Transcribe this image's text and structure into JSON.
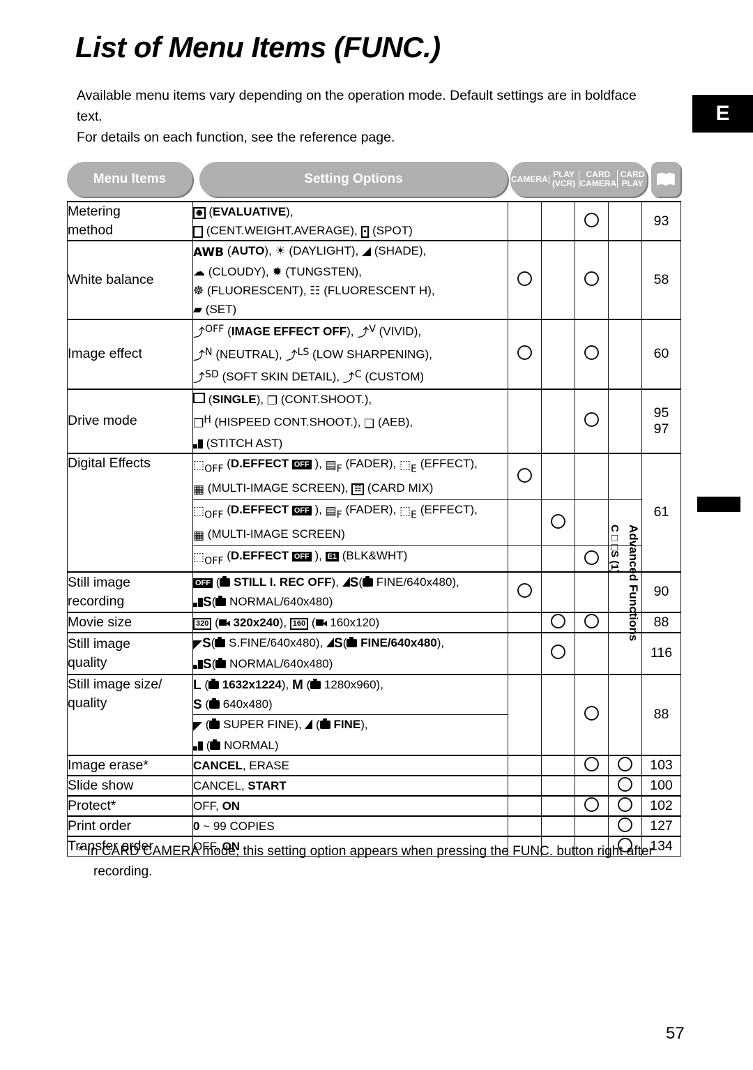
{
  "header": {
    "title": "List of Menu Items (FUNC.)",
    "intro_line1": "Available menu items vary depending on the operation mode. Default settings are in boldface text.",
    "intro_line2": "For details on each function, see the reference page.",
    "edition_badge": "E"
  },
  "table": {
    "col_menu_items": "Menu Items",
    "col_setting_options": "Setting Options",
    "mode_columns": [
      {
        "line1": "CAMERA",
        "line2": ""
      },
      {
        "line1": "PLAY",
        "line2": "(VCR)"
      },
      {
        "line1": "CARD",
        "line2": "CAMERA"
      },
      {
        "line1": "CARD",
        "line2": "PLAY"
      }
    ],
    "reference_icon": "open-book-icon",
    "rows": [
      {
        "name": "Metering\nmethod",
        "options_html": "<span class=\"gbox\">◉</span> (<b>EVALUATIVE</b>),<br><span class=\"gbox\">&nbsp;&nbsp;</span> (CENT.WEIGHT.AVERAGE), <span class=\"gbox\">▪</span> (SPOT)",
        "options_text": "(EVALUATIVE), (CENT.WEIGHT.AVERAGE), (SPOT)",
        "marks": [
          false,
          false,
          true,
          false
        ],
        "ref": "93"
      },
      {
        "name": "White balance",
        "options_html": "<b class=\"g\">AWB</b> (<b>AUTO</b>), ☀ (DAYLIGHT), ◢ (SHADE),<br>☁ (CLOUDY), ✹ (TUNGSTEN),<br>☸ (FLUORESCENT), ☷ (FLUORESCENT H),<br>▰ (SET)",
        "options_text": "AWB (AUTO), (DAYLIGHT), (SHADE), (CLOUDY), (TUNGSTEN), (FLUORESCENT), (FLUORESCENT H), (SET)",
        "marks": [
          true,
          false,
          true,
          false
        ],
        "ref": "58"
      },
      {
        "name": "Image effect",
        "options_html": "<span class=\"g\">⤴<sup>OFF</sup></span> (<b>IMAGE EFFECT OFF</b>), <span class=\"g\">⤴<sup>V</sup></span> (VIVID),<br><span class=\"g\">⤴<sup>N</sup></span> (NEUTRAL), <span class=\"g\">⤴<sup>LS</sup></span> (LOW SHARPENING),<br><span class=\"g\">⤴<sup>SD</sup></span> (SOFT SKIN DETAIL), <span class=\"g\">⤴<sup>C</sup></span> (CUSTOM)",
        "options_text": "(IMAGE EFFECT OFF), (VIVID), (NEUTRAL), (LOW SHARPENING), (SOFT SKIN DETAIL), (CUSTOM)",
        "marks": [
          true,
          false,
          true,
          false
        ],
        "ref": "60"
      },
      {
        "name": "Drive mode",
        "options_html": "<span class=\"gsq\"></span> (<b>SINGLE</b>), <span class=\"g\">❐</span> (CONT.SHOOT.),<br><span class=\"g\">❐<sup>H</sup></span> (HISPEED CONT.SHOOT.), <span class=\"g\">❑</span> (AEB),<br><span class=\"gstep\"></span> (STITCH AST)",
        "options_text": "(SINGLE), (CONT.SHOOT.), (HISPEED CONT.SHOOT.), (AEB), (STITCH AST)",
        "marks": [
          false,
          false,
          true,
          false
        ],
        "ref": "95\n97"
      },
      {
        "name": "Digital Effects",
        "sub_rows": [
          {
            "options_html": "<span class=\"g\">⬚<sub>OFF</sub></span> (<b>D.EFFECT <span class=\"ginv\">OFF</span></b> ), <span class=\"g\">▤<sub>F</sub></span> (FADER), <span class=\"g\">⬚<sub>E</sub></span> (EFFECT),<br><span class=\"g\">▦</span> (MULTI-IMAGE SCREEN), <span class=\"gbox\">☷</span> (CARD MIX)",
            "options_text": "(D.EFFECT OFF), (FADER), (EFFECT), (MULTI-IMAGE SCREEN), (CARD MIX)",
            "marks": [
              true,
              false,
              false,
              false
            ]
          },
          {
            "options_html": "<span class=\"g\">⬚<sub>OFF</sub></span> (<b>D.EFFECT <span class=\"ginv\">OFF</span></b> ), <span class=\"g\">▤<sub>F</sub></span> (FADER), <span class=\"g\">⬚<sub>E</sub></span> (EFFECT),<br><span class=\"g\">▦</span> (MULTI-IMAGE SCREEN)",
            "options_text": "(D.EFFECT OFF), (FADER), (EFFECT), (MULTI-IMAGE SCREEN)",
            "marks": [
              false,
              true,
              false,
              false
            ]
          },
          {
            "options_html": "<span class=\"g\">⬚<sub>OFF</sub></span> (<b>D.EFFECT <span class=\"ginv\">OFF</span></b> ), <span class=\"ginv\">E1</span> (BLK&amp;WHT)",
            "options_text": "(D.EFFECT OFF), (BLK&WHT)",
            "marks": [
              false,
              false,
              true,
              false
            ]
          }
        ],
        "ref": "61"
      },
      {
        "name": "Still image\nrecording",
        "options_html": "<span class=\"ginv\">OFF</span> (<b><span class=\"gcam\"></span> STILL I. REC OFF</b>), <span class=\"gtri\"></span><span class=\"gS\">S</span>(<span class=\"gcam\"></span> FINE/640x480),<br><span class=\"gstep\"></span><span class=\"gS\">S</span>(<span class=\"gcam\"></span> NORMAL/640x480)",
        "options_text": "(STILL I. REC OFF), (FINE/640x480), (NORMAL/640x480)",
        "marks": [
          true,
          false,
          false,
          false
        ],
        "ref": "90"
      },
      {
        "name": "Movie size",
        "options_html": "<span class=\"gbox\">320</span> (<span class=\"gvid\"></span> <b>320x240</b>), <span class=\"gbox\">160</span> (<span class=\"gvid\"></span> 160x120)",
        "options_text": "(320x240), (160x120)",
        "marks": [
          false,
          true,
          true,
          false
        ],
        "ref": "88"
      },
      {
        "name": "Still image\nquality",
        "options_html": "<span class=\"g\">◤</span><span class=\"gS\">S</span>(<span class=\"gcam\"></span> S.FINE/640x480), <span class=\"gtri\"></span><span class=\"gS\">S</span>(<span class=\"gcam\"></span> <b>FINE/640x480</b>),<br><span class=\"gstep\"></span><span class=\"gS\">S</span>(<span class=\"gcam\"></span> NORMAL/640x480)",
        "options_text": "(S.FINE/640x480), (FINE/640x480), (NORMAL/640x480)",
        "marks": [
          false,
          true,
          false,
          false
        ],
        "ref": "116"
      },
      {
        "name": "Still image size/\nquality",
        "sub_rows": [
          {
            "options_html": "<span class=\"gL\">L</span> (<span class=\"gcam\"></span> <b>1632x1224</b>), <span class=\"gL\">M</span> (<span class=\"gcam\"></span> 1280x960),<br><span class=\"gL\">S</span> (<span class=\"gcam\"></span> 640x480)",
            "options_text": "L (1632x1224), M (1280x960), S (640x480)",
            "marks": []
          },
          {
            "options_html": "<span class=\"g\">◤</span> (<span class=\"gcam\"></span> SUPER FINE), <span class=\"gtri\"></span> (<span class=\"gcam\"></span> <b>FINE</b>),<br><span class=\"gstep\"></span> (<span class=\"gcam\"></span> NORMAL)",
            "options_text": "(SUPER FINE), (FINE), (NORMAL)",
            "marks": []
          }
        ],
        "marks": [
          false,
          false,
          true,
          false
        ],
        "ref": "88"
      },
      {
        "name": "Image erase*",
        "options_html": "<b>CANCEL</b>, ERASE",
        "options_text": "CANCEL, ERASE",
        "marks": [
          false,
          false,
          true,
          true
        ],
        "ref": "103"
      },
      {
        "name": "Slide show",
        "options_html": "CANCEL, <b>START</b>",
        "options_text": "CANCEL, START",
        "marks": [
          false,
          false,
          false,
          true
        ],
        "ref": "100"
      },
      {
        "name": "Protect*",
        "options_html": "OFF, <b>ON</b>",
        "options_text": "OFF, ON",
        "marks": [
          false,
          false,
          true,
          true
        ],
        "ref": "102"
      },
      {
        "name": "Print order",
        "options_html": "<b>0</b> ~ 99 COPIES",
        "options_text": "0 ~ 99 COPIES",
        "marks": [
          false,
          false,
          false,
          true
        ],
        "ref": "127"
      },
      {
        "name": "Transfer order",
        "options_html": "OFF, <b>ON</b>",
        "options_text": "OFF, ON",
        "marks": [
          false,
          false,
          false,
          true
        ],
        "ref": "134"
      }
    ]
  },
  "footnote": "* In CARD CAMERA mode, this setting option appears when pressing the FUNC. button right after recording.",
  "side_tab": {
    "label": "Advanced Functions",
    "sub_label": "C □ □S (1)"
  },
  "page_number": "57"
}
